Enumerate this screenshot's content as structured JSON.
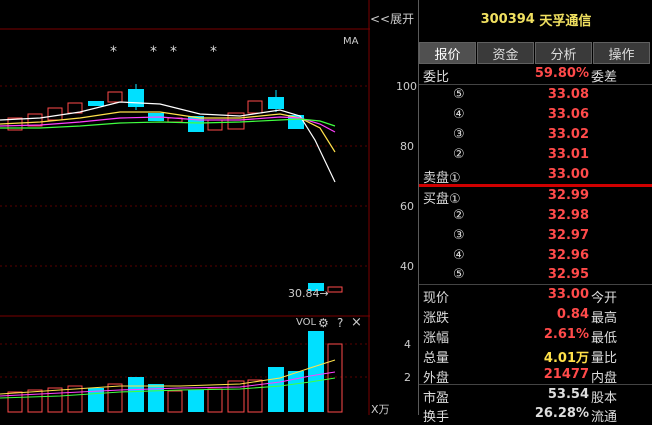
{
  "toolbar": {
    "expand_label": "<<展开"
  },
  "chart": {
    "ma_label": "MA",
    "stars": [
      "*",
      "*",
      "*",
      "*"
    ],
    "price_axis": [
      "100",
      "80",
      "60",
      "40"
    ],
    "vol_axis": [
      "4",
      "2"
    ],
    "vol_unit": "X万",
    "low_marker": "30.84→",
    "vol_label": "VOL",
    "help": "?",
    "close": "×"
  },
  "chart_data": {
    "type": "candlestick",
    "price_axis_ticks": [
      100,
      80,
      60,
      40
    ],
    "low_marker_value": 30.84,
    "volume_axis_ticks": [
      4,
      2
    ],
    "volume_unit": "万"
  },
  "panel": {
    "stock_code": "300394",
    "stock_name": "天孚通信",
    "tabs": [
      "报价",
      "资金",
      "分析",
      "操作"
    ],
    "weibi_label": "委比",
    "weibi_value": "59.80%",
    "weicha_label": "委差",
    "sell_label": "卖盘①",
    "buy_label": "买盘①",
    "sell_levels": [
      {
        "mark": "⑤",
        "price": "33.08"
      },
      {
        "mark": "④",
        "price": "33.06"
      },
      {
        "mark": "③",
        "price": "33.02"
      },
      {
        "mark": "②",
        "price": "33.01"
      },
      {
        "mark": "",
        "price": "33.00"
      }
    ],
    "buy_levels": [
      {
        "mark": "",
        "price": "32.99"
      },
      {
        "mark": "②",
        "price": "32.98"
      },
      {
        "mark": "③",
        "price": "32.97"
      },
      {
        "mark": "④",
        "price": "32.96"
      },
      {
        "mark": "⑤",
        "price": "32.95"
      }
    ],
    "stats": [
      {
        "label": "现价",
        "value": "33.00",
        "label2": "今开",
        "color": "red"
      },
      {
        "label": "涨跌",
        "value": "0.84",
        "label2": "最高",
        "color": "red"
      },
      {
        "label": "涨幅",
        "value": "2.61%",
        "label2": "最低",
        "color": "red"
      },
      {
        "label": "总量",
        "value": "4.01万",
        "label2": "量比",
        "color": "yellow"
      },
      {
        "label": "外盘",
        "value": "21477",
        "label2": "内盘",
        "color": "red"
      },
      {
        "label": "市盈",
        "value": "53.54",
        "label2": "股本",
        "color": "white"
      },
      {
        "label": "换手",
        "value": "26.28%",
        "label2": "流通",
        "color": "white"
      }
    ]
  }
}
